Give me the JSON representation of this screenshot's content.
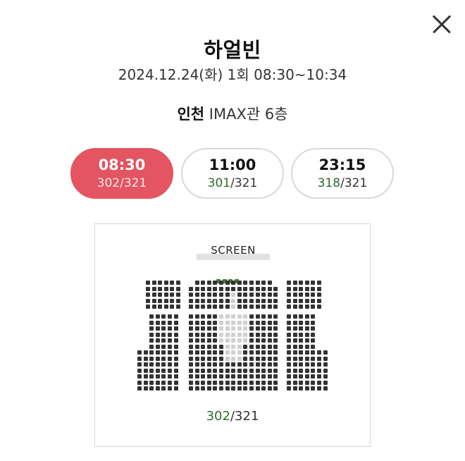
{
  "movie": {
    "title": "하얼빈",
    "datetime": "2024.12.24(화) 1회 08:30~10:34",
    "region": "인천",
    "hall": " IMAX관 6층"
  },
  "showtimes": [
    {
      "time": "08:30",
      "remaining": "302",
      "total": "/321",
      "selected": true
    },
    {
      "time": "11:00",
      "remaining": "301",
      "total": "/321",
      "selected": false
    },
    {
      "time": "23:15",
      "remaining": "318",
      "total": "/321",
      "selected": false
    }
  ],
  "seatmap": {
    "screen_label": "SCREEN",
    "remaining": "302",
    "total": "/321"
  },
  "icons": {
    "close": "close-icon"
  },
  "colors": {
    "selected_time_bg": "#e35561",
    "available_count": "#2e6b2e",
    "seat_available": "#333333",
    "seat_sold": "#d0d0d0",
    "seat_highlight": "#3f7a34"
  }
}
